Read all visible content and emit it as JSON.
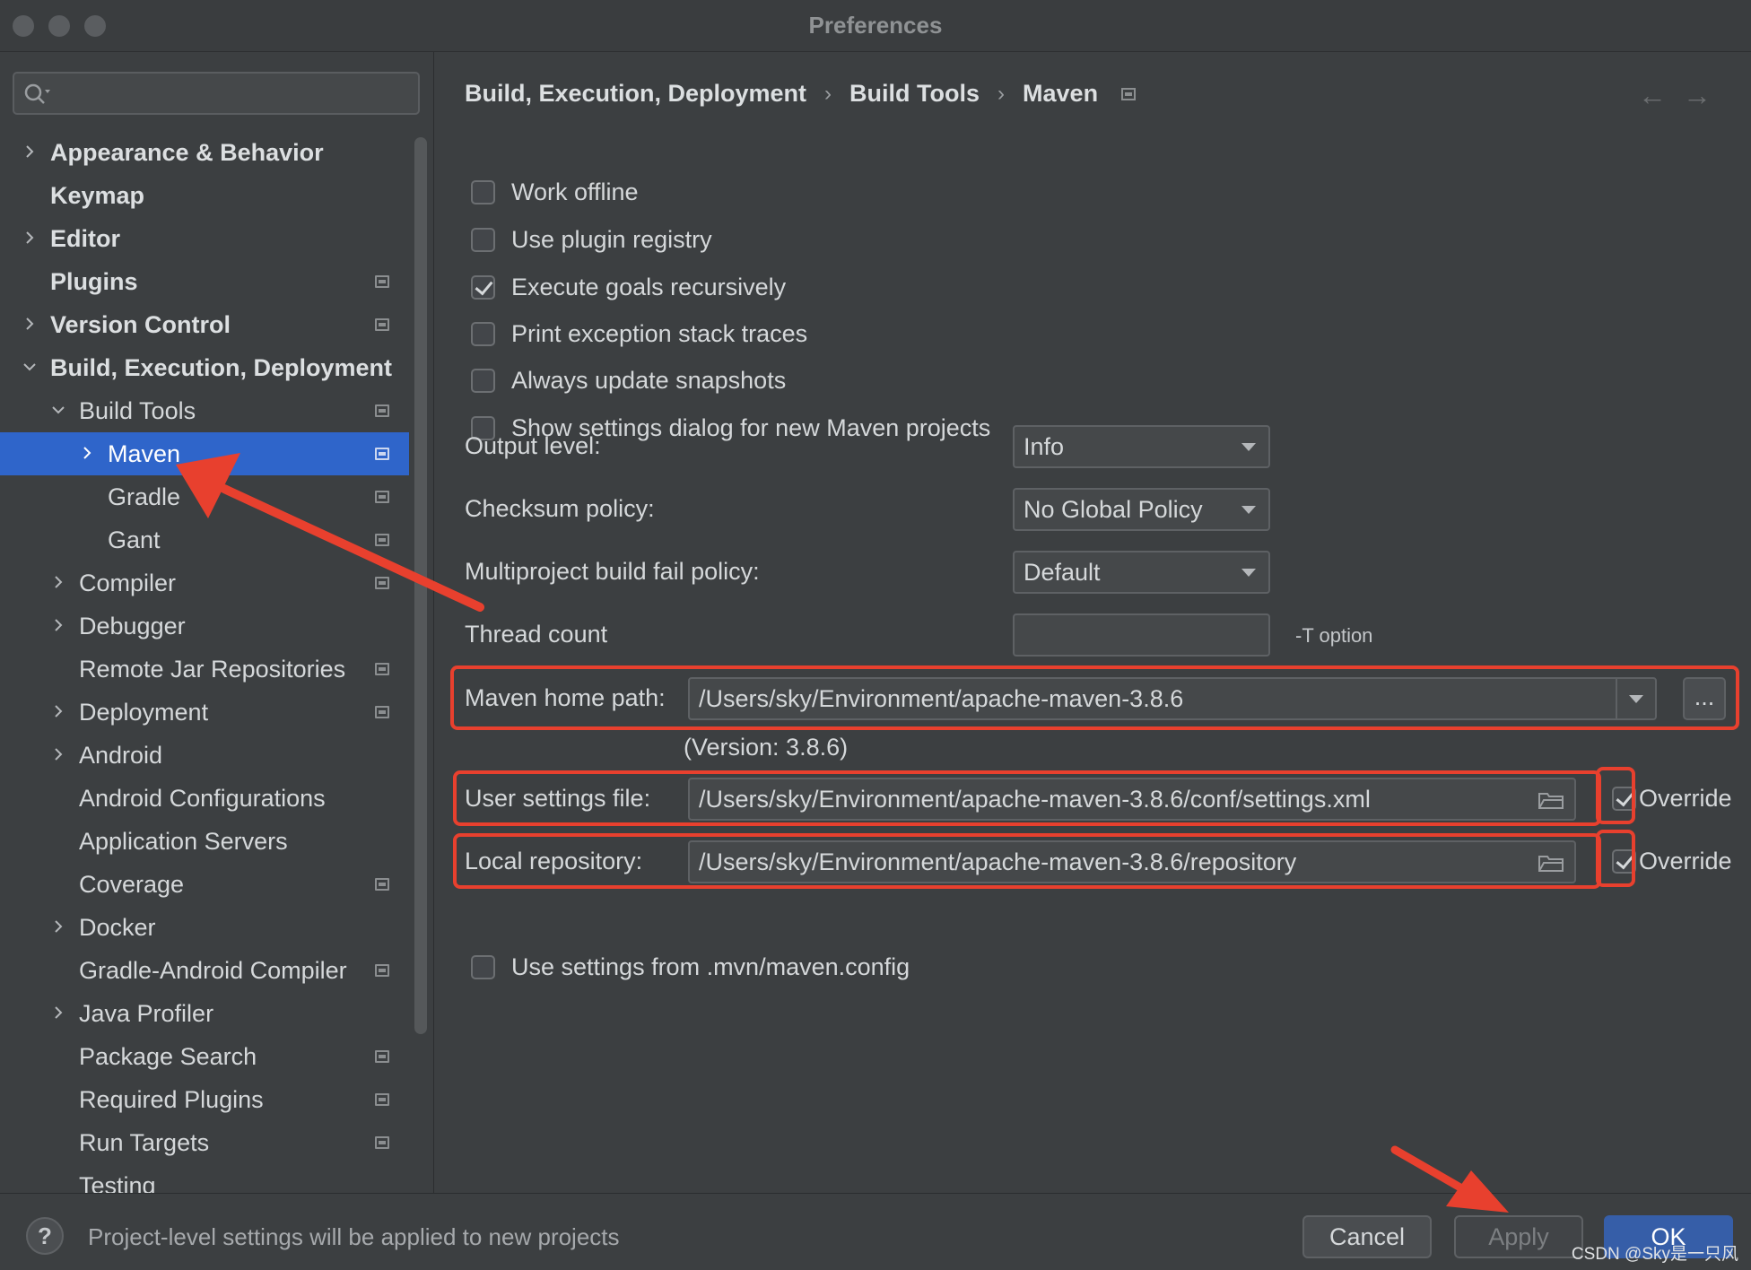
{
  "window": {
    "title": "Preferences"
  },
  "sidebar": {
    "search_placeholder": "",
    "items": [
      {
        "label": "Appearance & Behavior"
      },
      {
        "label": "Keymap"
      },
      {
        "label": "Editor"
      },
      {
        "label": "Plugins"
      },
      {
        "label": "Version Control"
      },
      {
        "label": "Build, Execution, Deployment"
      },
      {
        "label": "Build Tools"
      },
      {
        "label": "Maven"
      },
      {
        "label": "Gradle"
      },
      {
        "label": "Gant"
      },
      {
        "label": "Compiler"
      },
      {
        "label": "Debugger"
      },
      {
        "label": "Remote Jar Repositories"
      },
      {
        "label": "Deployment"
      },
      {
        "label": "Android"
      },
      {
        "label": "Android Configurations"
      },
      {
        "label": "Application Servers"
      },
      {
        "label": "Coverage"
      },
      {
        "label": "Docker"
      },
      {
        "label": "Gradle-Android Compiler"
      },
      {
        "label": "Java Profiler"
      },
      {
        "label": "Package Search"
      },
      {
        "label": "Required Plugins"
      },
      {
        "label": "Run Targets"
      },
      {
        "label": "Testing"
      }
    ]
  },
  "breadcrumb": [
    "Build, Execution, Deployment",
    "Build Tools",
    "Maven"
  ],
  "options": [
    {
      "label": "Work offline",
      "checked": false
    },
    {
      "label": "Use plugin registry",
      "checked": false
    },
    {
      "label": "Execute goals recursively",
      "checked": true
    },
    {
      "label": "Print exception stack traces",
      "checked": false
    },
    {
      "label": "Always update snapshots",
      "checked": false
    },
    {
      "label": "Show settings dialog for new Maven projects",
      "checked": false
    }
  ],
  "settings": {
    "output_level_label": "Output level:",
    "output_level_value": "Info",
    "checksum_label": "Checksum policy:",
    "checksum_value": "No Global Policy",
    "multiproject_label": "Multiproject build fail policy:",
    "multiproject_value": "Default",
    "thread_count_label": "Thread count",
    "thread_count_value": "",
    "thread_count_hint": "-T option",
    "maven_home_label": "Maven home path:",
    "maven_home_value": "/Users/sky/Environment/apache-maven-3.8.6",
    "maven_home_browse": "...",
    "maven_version": "(Version: 3.8.6)",
    "user_settings_label": "User settings file:",
    "user_settings_value": "/Users/sky/Environment/apache-maven-3.8.6/conf/settings.xml",
    "user_settings_override_label": "Override",
    "user_settings_override_checked": true,
    "local_repo_label": "Local repository:",
    "local_repo_value": "/Users/sky/Environment/apache-maven-3.8.6/repository",
    "local_repo_override_label": "Override",
    "local_repo_override_checked": true,
    "mvn_config_label": "Use settings from .mvn/maven.config",
    "mvn_config_checked": false
  },
  "footer": {
    "help_label": "?",
    "status": "Project-level settings will be applied to new projects",
    "cancel": "Cancel",
    "apply": "Apply",
    "ok": "OK",
    "watermark": "CSDN @Sky是一只风"
  },
  "colors": {
    "selection": "#2f65ca",
    "annotation_red": "#e8402e",
    "primary_button": "#365ea8"
  }
}
